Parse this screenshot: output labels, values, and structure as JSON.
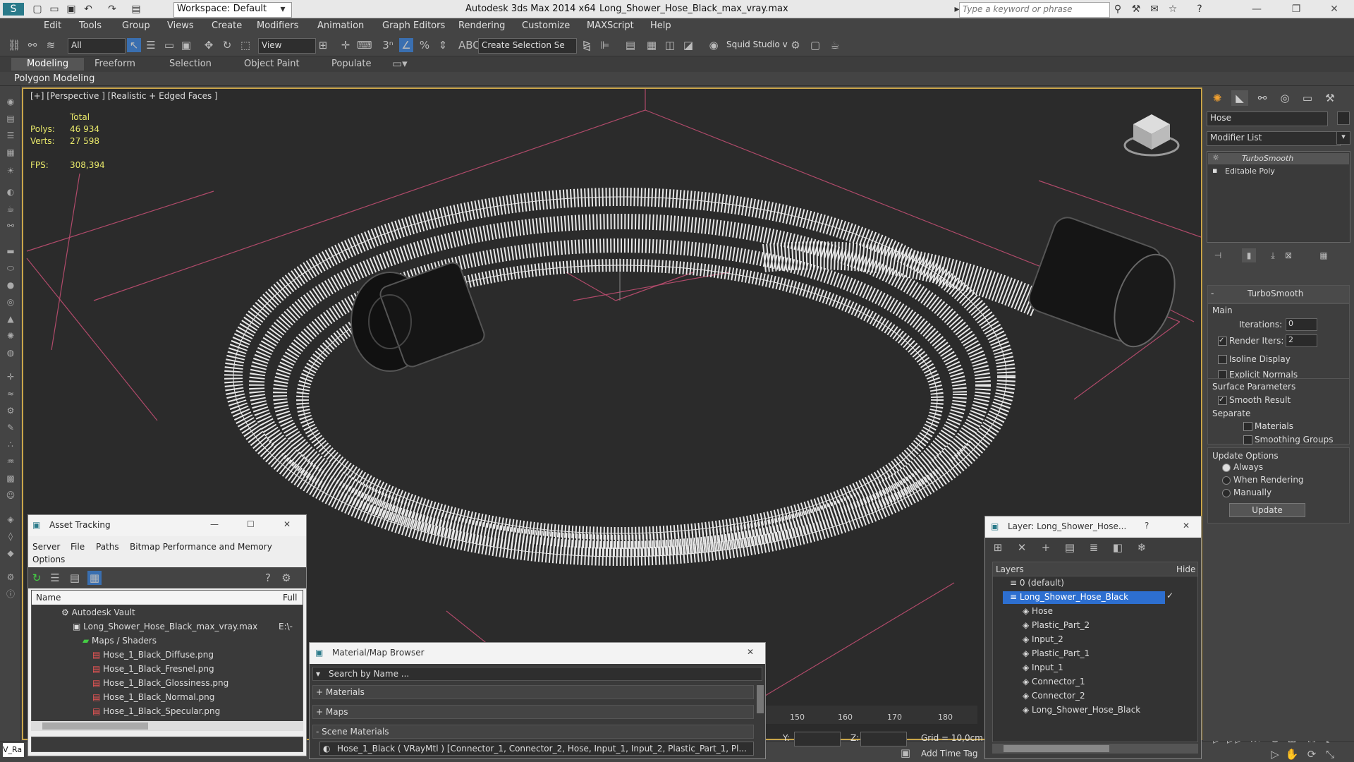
{
  "app": {
    "title": "Autodesk 3ds Max  2014 x64",
    "file": "Long_Shower_Hose_Black_max_vray.max",
    "workspace": "Workspace: Default",
    "search_placeholder": "Type a keyword or phrase"
  },
  "menu": [
    "Edit",
    "Tools",
    "Group",
    "Views",
    "Create",
    "Modifiers",
    "Animation",
    "Graph Editors",
    "Rendering",
    "Customize",
    "MAXScript",
    "Help"
  ],
  "toolbar": {
    "selection_filter": "All",
    "ref_coord": "View",
    "named_selection": "Create Selection Se",
    "plugin": "Squid Studio v"
  },
  "ribbon": {
    "tabs": [
      "Modeling",
      "Freeform",
      "Selection",
      "Object Paint",
      "Populate"
    ],
    "active": "Modeling",
    "sub": "Polygon Modeling"
  },
  "viewport": {
    "label": "[+] [Perspective ] [Realistic + Edged Faces ]",
    "stats": {
      "total": "Total",
      "polys_label": "Polys:",
      "polys": "46 934",
      "verts_label": "Verts:",
      "verts": "27 598",
      "fps_label": "FPS:",
      "fps": "308,394"
    }
  },
  "command_panel": {
    "object_name": "Hose",
    "modifier_list": "Modifier List",
    "stack": [
      "TurboSmooth",
      "Editable Poly"
    ],
    "turbosmooth": {
      "title": "TurboSmooth",
      "main": "Main",
      "iterations_label": "Iterations:",
      "iterations": "0",
      "render_iters_label": "Render Iters:",
      "render_iters": "2",
      "isoline": "Isoline Display",
      "explicit_normals": "Explicit Normals",
      "surface_params": "Surface Parameters",
      "smooth_result": "Smooth Result",
      "separate": "Separate",
      "materials": "Materials",
      "smoothing_groups": "Smoothing Groups",
      "update_options": "Update Options",
      "always": "Always",
      "when_rendering": "When Rendering",
      "manually": "Manually",
      "update_btn": "Update"
    }
  },
  "asset_tracking": {
    "title": "Asset Tracking",
    "menu": [
      "Server",
      "File",
      "Paths",
      "Bitmap Performance and Memory",
      "Options"
    ],
    "col_name": "Name",
    "col_full": "Full",
    "rows": [
      {
        "name": "Autodesk Vault",
        "full": ""
      },
      {
        "name": "Long_Shower_Hose_Black_max_vray.max",
        "full": "E:\\-"
      },
      {
        "name": "Maps / Shaders",
        "full": ""
      },
      {
        "name": "Hose_1_Black_Diffuse.png",
        "full": ""
      },
      {
        "name": "Hose_1_Black_Fresnel.png",
        "full": ""
      },
      {
        "name": "Hose_1_Black_Glossiness.png",
        "full": ""
      },
      {
        "name": "Hose_1_Black_Normal.png",
        "full": ""
      },
      {
        "name": "Hose_1_Black_Specular.png",
        "full": ""
      }
    ]
  },
  "material_browser": {
    "title": "Material/Map Browser",
    "search": "Search by Name ...",
    "sections": [
      "+ Materials",
      "+ Maps",
      "- Scene Materials"
    ],
    "item": "Hose_1_Black  ( VRayMtl )  [Connector_1, Connector_2, Hose, Input_1, Input_2, Plastic_Part_1, Pl..."
  },
  "layers": {
    "title": "Layer: Long_Shower_Hose...",
    "col_layers": "Layers",
    "col_hide": "Hide",
    "rows": [
      "0 (default)",
      "Long_Shower_Hose_Black",
      "Hose",
      "Plastic_Part_2",
      "Input_2",
      "Plastic_Part_1",
      "Input_1",
      "Connector_1",
      "Connector_2",
      "Long_Shower_Hose_Black"
    ]
  },
  "timeline": {
    "ticks": [
      "150",
      "160",
      "170",
      "180"
    ]
  },
  "status": {
    "y_label": "Y:",
    "z_label": "Z:",
    "grid": "Grid = 10,0cm",
    "add_time_tag": "Add Time Tag",
    "script": "V_Ra"
  }
}
